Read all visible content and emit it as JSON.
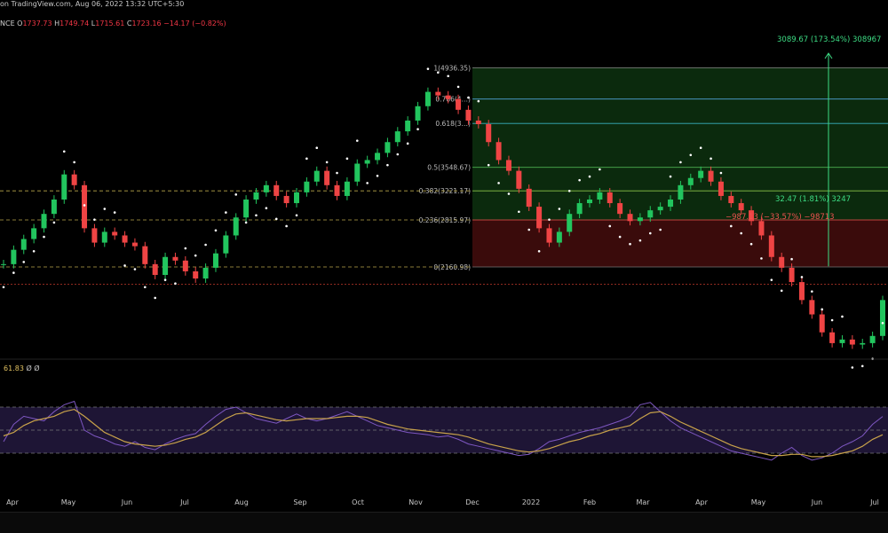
{
  "header": {
    "attribution": "on TradingView.com, Aug 06, 2022 13:32 UTC+5:30",
    "symbol_suffix": "NCE",
    "open_label": "O",
    "open": "1737.73",
    "high_label": "H",
    "high": "1749.74",
    "low_label": "L",
    "low": "1715.61",
    "close_label": "C",
    "close": "1723.16",
    "change": "−14.17 (−0.82%)"
  },
  "rsi_panel": {
    "value": "61.83",
    "extra1": "Ø",
    "extra2": "Ø"
  },
  "colors": {
    "up": "#26a69a",
    "up_bright": "#22c55e",
    "down": "#ef4444",
    "rsi_line": "#7e57c2",
    "rsi_ma": "#c8a24a",
    "rsi_band": "#1e1535",
    "fib_green": "#0b2a0d",
    "fib_red": "#3a0b0b",
    "sar": "#ffffff"
  },
  "chart_data": [
    {
      "type": "candlestick",
      "title": "",
      "x_ticks": [
        "Apr",
        "May",
        "Jun",
        "Jul",
        "Aug",
        "Sep",
        "Oct",
        "Nov",
        "Dec",
        "2022",
        "Feb",
        "Mar",
        "Apr",
        "May",
        "Jun",
        "Jul"
      ],
      "fib_levels": [
        {
          "label": "1(4936.35)",
          "value": 4936.35
        },
        {
          "label": "0.786(4…)",
          "value": 4500
        },
        {
          "label": "0.618(3…)",
          "value": 4160
        },
        {
          "label": "0.5(3548.67)",
          "value": 3548.67
        },
        {
          "label": "0.382(3221.17)",
          "value": 3221.17
        },
        {
          "label": "0.236(2815.97)",
          "value": 2815.97
        },
        {
          "label": "0(2160.98)",
          "value": 2160.98
        }
      ],
      "annotations": {
        "long_target": "3089.67 (173.54%) 308967",
        "long_mid": "32.47 (1.81%) 3247",
        "short_stop": "−987.13 (−33.57%) −98713"
      },
      "close_path": [
        2200,
        2400,
        2550,
        2700,
        2900,
        3100,
        3450,
        3300,
        2700,
        2500,
        2650,
        2600,
        2500,
        2450,
        2200,
        2050,
        2300,
        2250,
        2100,
        2000,
        2150,
        2350,
        2600,
        2850,
        3100,
        3200,
        3300,
        3150,
        3050,
        3200,
        3350,
        3500,
        3300,
        3150,
        3350,
        3600,
        3650,
        3750,
        3900,
        4050,
        4200,
        4400,
        4600,
        4550,
        4500,
        4350,
        4200,
        4150,
        3900,
        3650,
        3500,
        3250,
        3000,
        2700,
        2500,
        2650,
        2900,
        3050,
        3100,
        3200,
        3050,
        2900,
        2800,
        2850,
        2950,
        3000,
        3100,
        3300,
        3400,
        3500,
        3350,
        3150,
        3050,
        2950,
        2800,
        2600,
        2300,
        2150,
        1950,
        1700,
        1500,
        1250,
        1100,
        1150,
        1080,
        1100,
        1200,
        1700
      ]
    },
    {
      "type": "line",
      "title": "RSI",
      "ylim": [
        0,
        100
      ],
      "bands": [
        30,
        50,
        70
      ],
      "rsi_path": [
        40,
        55,
        62,
        60,
        58,
        66,
        72,
        75,
        50,
        45,
        42,
        38,
        36,
        40,
        35,
        33,
        38,
        42,
        45,
        47,
        55,
        62,
        68,
        70,
        65,
        60,
        58,
        56,
        60,
        64,
        60,
        58,
        60,
        63,
        66,
        62,
        58,
        54,
        52,
        50,
        48,
        47,
        46,
        44,
        45,
        42,
        38,
        36,
        34,
        32,
        30,
        28,
        29,
        34,
        40,
        42,
        45,
        48,
        50,
        52,
        55,
        58,
        62,
        72,
        74,
        66,
        58,
        52,
        48,
        44,
        40,
        36,
        32,
        30,
        28,
        26,
        24,
        30,
        35,
        28,
        24,
        26,
        30,
        36,
        40,
        45,
        55,
        61.83
      ],
      "ma_path": [
        45,
        48,
        54,
        58,
        60,
        62,
        66,
        68,
        62,
        55,
        48,
        44,
        40,
        38,
        37,
        36,
        37,
        39,
        42,
        44,
        48,
        54,
        60,
        64,
        65,
        63,
        61,
        59,
        58,
        59,
        60,
        60,
        60,
        61,
        62,
        62,
        61,
        58,
        55,
        53,
        51,
        50,
        49,
        48,
        47,
        46,
        44,
        41,
        38,
        36,
        34,
        32,
        31,
        32,
        34,
        37,
        40,
        42,
        45,
        47,
        50,
        52,
        54,
        60,
        65,
        66,
        62,
        57,
        53,
        49,
        45,
        41,
        37,
        34,
        32,
        30,
        28,
        28,
        29,
        29,
        27,
        27,
        28,
        30,
        32,
        36,
        42,
        46
      ]
    }
  ]
}
